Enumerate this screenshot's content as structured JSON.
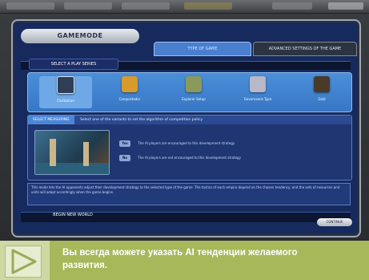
{
  "window": {
    "title": "GAMEMODE"
  },
  "tabs": [
    {
      "label": "TYPE OF GAME"
    },
    {
      "label": "ADVANCED SETTINGS OF THE GAME"
    }
  ],
  "section_select": {
    "label": "SELECT A PLAY SERIES"
  },
  "modes": [
    {
      "label": "Civilization",
      "icon": "civilization-icon"
    },
    {
      "label": "Conquistador",
      "icon": "conquistador-icon"
    },
    {
      "label": "Explorer Setup",
      "icon": "explorer-icon"
    },
    {
      "label": "Governance Type",
      "icon": "governance-icon"
    },
    {
      "label": "Gold",
      "icon": "gold-icon"
    }
  ],
  "description": {
    "label": "SELECT MEASURING",
    "text": "Select one of the variants to set the algorithm of competition policy",
    "options": [
      {
        "radio": "Yes",
        "text": "The AI players are encouraged to this development strategy"
      },
      {
        "radio": "No",
        "text": "The AI players are not encouraged to this development strategy"
      }
    ]
  },
  "note": {
    "text": "This mode lets the AI opponents adjust their development strategy to the selected type of the game. The tactics of each empire depend on the chosen tendency, and the sets of resources and units will adapt accordingly when the game begins."
  },
  "footer": {
    "label": "BEGIN NEW WORLD",
    "next_button": "CONTINUE"
  },
  "caption": {
    "text": "Вы всегда можете указать AI тенденции желаемого развития."
  },
  "colors": {
    "frame": "#162a5e",
    "mode_panel": "#4b8fd8",
    "caption_bg": "#a6b85a",
    "caption_text": "#ffffff"
  }
}
